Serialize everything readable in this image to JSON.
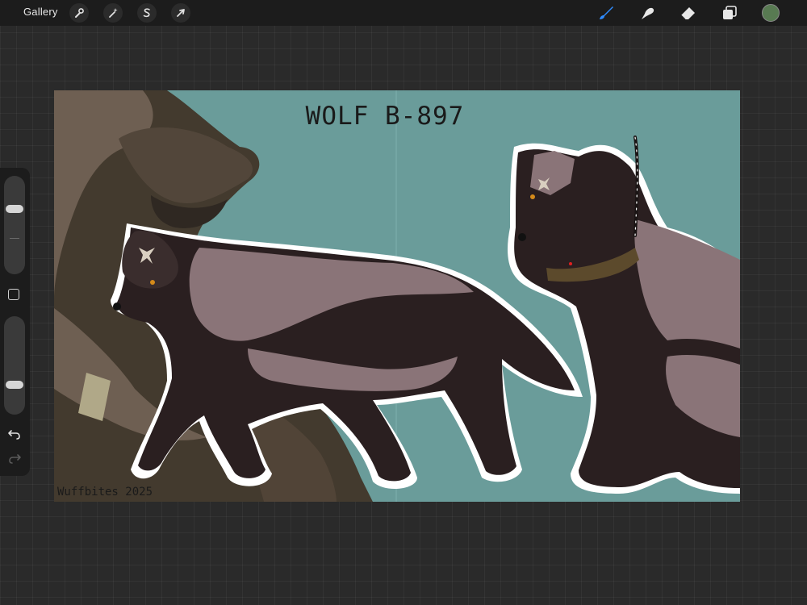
{
  "topbar": {
    "gallery_label": "Gallery",
    "left_tools": [
      {
        "name": "actions",
        "icon": "wrench-icon"
      },
      {
        "name": "adjustments",
        "icon": "magic-wand-icon"
      },
      {
        "name": "selection",
        "icon": "selection-s-icon"
      },
      {
        "name": "transform",
        "icon": "arrow-cursor-icon"
      }
    ],
    "right_tools": [
      {
        "name": "brush",
        "icon": "brush-icon",
        "active": true
      },
      {
        "name": "smudge",
        "icon": "smudge-finger-icon",
        "active": false
      },
      {
        "name": "eraser",
        "icon": "eraser-icon",
        "active": false
      },
      {
        "name": "layers",
        "icon": "layers-icon",
        "active": false
      }
    ],
    "current_color": "#587a52",
    "accent_color": "#2f8cff"
  },
  "sidebar": {
    "brush_size_level": 0.82,
    "opacity_level": 0.32
  },
  "canvas": {
    "title": "WOLF B-897",
    "signature": "Wuffbites 2025",
    "background_color": "#6a9c9a"
  }
}
